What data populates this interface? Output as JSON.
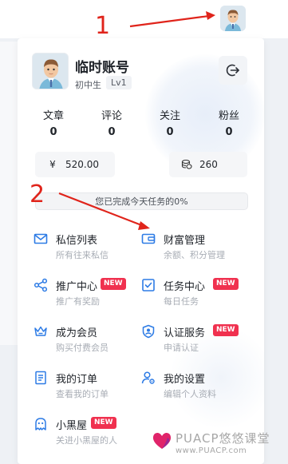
{
  "annotations": {
    "label_1": "1",
    "label_2": "2"
  },
  "profile": {
    "name": "临时账号",
    "role": "初中生",
    "level": "Lv1"
  },
  "icons": {
    "top_avatar": "user-avatar-icon",
    "logout": "logout-icon"
  },
  "stats": [
    {
      "label": "文章",
      "value": "0"
    },
    {
      "label": "评论",
      "value": "0"
    },
    {
      "label": "关注",
      "value": "0"
    },
    {
      "label": "粉丝",
      "value": "0"
    }
  ],
  "wallet": {
    "balance_symbol": "¥",
    "balance": "520.00",
    "points": "260"
  },
  "task": {
    "text": "您已完成今天任务的0%",
    "progress": 0
  },
  "menu": [
    {
      "title": "私信列表",
      "sub": "所有往来私信",
      "icon": "mail-icon",
      "badge": ""
    },
    {
      "title": "财富管理",
      "sub": "余额、积分管理",
      "icon": "wallet-icon",
      "badge": ""
    },
    {
      "title": "推广中心",
      "sub": "推广有奖励",
      "icon": "share-icon",
      "badge": "NEW"
    },
    {
      "title": "任务中心",
      "sub": "每日任务",
      "icon": "checkbox-icon",
      "badge": "NEW"
    },
    {
      "title": "成为会员",
      "sub": "购买付费会员",
      "icon": "crown-icon",
      "badge": ""
    },
    {
      "title": "认证服务",
      "sub": "申请认证",
      "icon": "shield-user-icon",
      "badge": "NEW"
    },
    {
      "title": "我的订单",
      "sub": "查看我的订单",
      "icon": "order-icon",
      "badge": ""
    },
    {
      "title": "我的设置",
      "sub": "编辑个人资料",
      "icon": "user-settings-icon",
      "badge": ""
    },
    {
      "title": "小黑屋",
      "sub": "关进小黑屋的人",
      "icon": "ghost-icon",
      "badge": "NEW"
    }
  ],
  "watermark": {
    "text": "PUACP悠悠课堂",
    "url": "www.PUACP.com"
  },
  "colors": {
    "accent": "#2d7be5",
    "badge": "#f0314f",
    "annotation": "#e0241b"
  }
}
